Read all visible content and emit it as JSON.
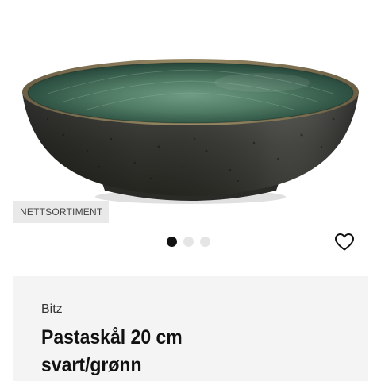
{
  "product": {
    "badge": "NETTSORTIMENT",
    "brand": "Bitz",
    "title_line1": "Pastaskål 20 cm",
    "title_line2": "svart/grønn"
  },
  "carousel": {
    "total_images": 3,
    "active_index": 0
  },
  "icons": {
    "favorite": "heart-outline-icon"
  },
  "colors": {
    "bowl_outer": "#3a3b38",
    "bowl_glaze": "#4f7a63",
    "badge_bg": "#e9e9e9",
    "panel_bg": "#f4f4f4",
    "active_dot": "#111111",
    "inactive_dot": "#e5e5e5"
  }
}
